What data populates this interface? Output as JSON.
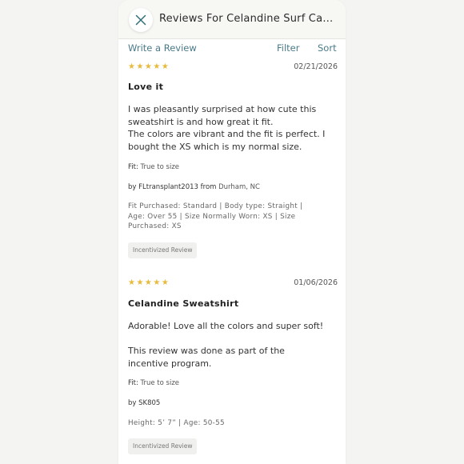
{
  "header": {
    "title": "Reviews For Celandine Surf Camp..."
  },
  "toolbar": {
    "write_label": "Write a Review",
    "filter_label": "Filter",
    "sort_label": "Sort"
  },
  "colors": {
    "accent": "#4a7a88",
    "star": "#e8b93a",
    "close_icon": "#2f6f7a"
  },
  "reviews": [
    {
      "stars": "★★★★★",
      "rating": 5,
      "date": "02/21/2026",
      "title": "Love it",
      "body": [
        "I was pleasantly surprised at how cute this\nsweatshirt is and how great it fit.",
        "The colors are vibrant and the fit is perfect.  I\nbought the XS which is my normal size."
      ],
      "fit_label": "Fit:",
      "fit_value": "True to size",
      "by_prefix": "by",
      "author": "FLtransplant2013",
      "from_label": "from",
      "location": "Durham, NC",
      "specs": "Fit Purchased: Standard   |   Body type: Straight   |\nAge: Over 55   |   Size Normally Worn: XS   |   Size\nPurchased: XS",
      "badge": "Incentivized Review"
    },
    {
      "stars": "★★★★★",
      "rating": 5,
      "date": "01/06/2026",
      "title": "Celandine Sweatshirt",
      "body": [
        "Adorable! Love all the colors and super soft!",
        "",
        "This review was done as part of the\nincentive program."
      ],
      "fit_label": "Fit:",
      "fit_value": "True to size",
      "by_prefix": "by",
      "author": "SK805",
      "specs": "Height: 5’ 7”   |   Age: 50-55",
      "badge": "Incentivized Review"
    }
  ]
}
